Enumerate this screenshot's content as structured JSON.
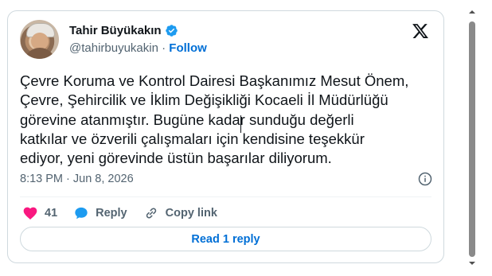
{
  "author": {
    "display_name": "Tahir Büyükakın",
    "handle": "@tahirbuyukakin",
    "separator": "·",
    "follow_label": "Follow"
  },
  "tweet": {
    "text": "Çevre Koruma ve Kontrol Dairesi Başkanımız Mesut Önem,\nÇevre, Şehircilik ve İklim Değişikliği Kocaeli İl Müdürlüğü\ngörevine atanmıştır. Bugüne kadar sunduğu değerli\nkatkılar ve özverili çalışmaları için kendisine teşekkür\nediyor, yeni görevinde üstün başarılar diliyorum.",
    "timestamp": "8:13 PM · Jun 8, 2026"
  },
  "actions": {
    "like_count": "41",
    "reply_label": "Reply",
    "copy_link_label": "Copy link"
  },
  "read_reply_label": "Read 1 reply",
  "colors": {
    "accent": "#006fd6",
    "like": "#f91880",
    "verified": "#1d9bf0",
    "muted_text": "#536471",
    "border": "#cfd9de"
  },
  "icons": [
    "verified-badge-icon",
    "x-logo-icon",
    "info-icon",
    "heart-icon",
    "reply-bubble-icon",
    "link-icon",
    "scroll-up-arrow-icon",
    "scroll-down-arrow-icon"
  ]
}
